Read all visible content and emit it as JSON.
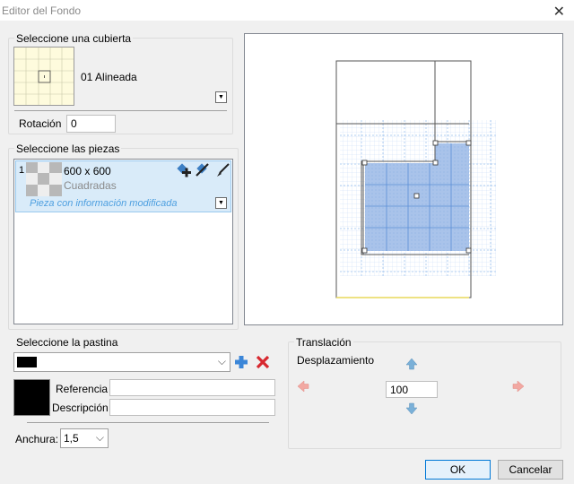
{
  "window": {
    "title": "Editor del Fondo",
    "close_glyph": "✕"
  },
  "cubierta": {
    "legend": "Seleccione una cubierta",
    "name": "01 Alineada",
    "rotation_label": "Rotación",
    "rotation_value": "0"
  },
  "piezas": {
    "legend": "Seleccione las piezas",
    "item": {
      "index": "1",
      "size": "600 x 600",
      "type": "Cuadradas",
      "note": "Pieza con información modificada"
    }
  },
  "pastina": {
    "legend": "Seleccione la pastina",
    "color": "#000000",
    "ref_label": "Referencia",
    "ref_value": "",
    "desc_label": "Descripción",
    "desc_value": "",
    "width_label": "Anchura:",
    "width_value": "1,5"
  },
  "traslacion": {
    "legend": "Translación",
    "offset_label": "Desplazamiento",
    "offset_value": "100"
  },
  "buttons": {
    "ok": "OK",
    "cancel": "Cancelar"
  },
  "colors": {
    "tile_fill": "#a9c3ea",
    "tile_grid": "#9ec0ef",
    "accent": "#0078d7",
    "arrow_active": "#7ab0d8",
    "arrow_disabled": "#f2a8a2"
  },
  "icons": [
    "dropdown-arrow-icon",
    "add-piece-icon",
    "delete-piece-icon",
    "brush-icon",
    "add-icon",
    "delete-icon",
    "arrow-up-icon",
    "arrow-down-icon",
    "arrow-left-icon",
    "arrow-right-icon"
  ]
}
